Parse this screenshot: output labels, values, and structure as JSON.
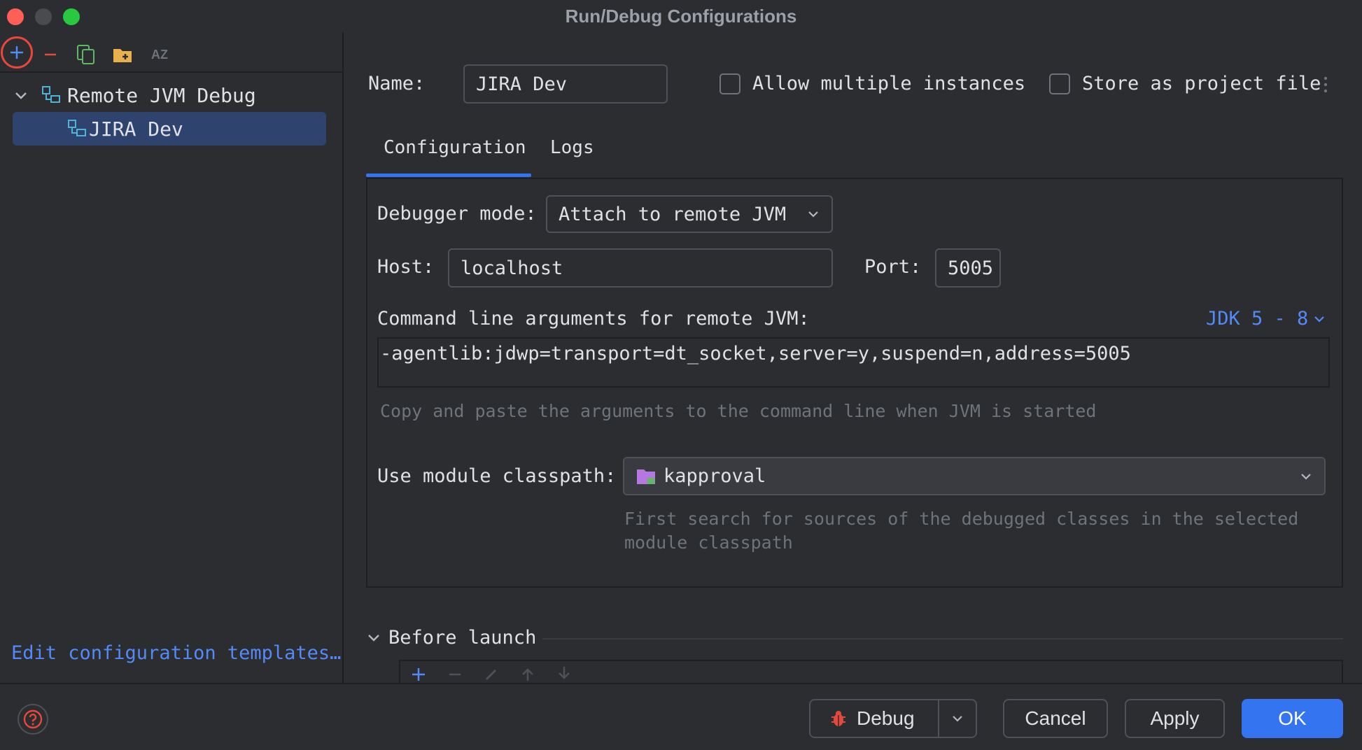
{
  "window": {
    "title": "Run/Debug Configurations"
  },
  "colors": {
    "background": "#2b2d30",
    "accent": "#3574f0",
    "link": "#548af7",
    "selection": "#2e436e",
    "close": "#ff5f57",
    "minimize": "#4a4b4f",
    "maximize": "#28c840"
  },
  "sidebar": {
    "toolbar": [
      {
        "icon": "plus-icon"
      },
      {
        "icon": "minus-icon"
      },
      {
        "icon": "copy-icon"
      },
      {
        "icon": "new-folder-icon"
      },
      {
        "icon": "sort-az-icon",
        "label": "AZ"
      }
    ],
    "tree": {
      "group_label": "Remote JVM Debug",
      "items": [
        {
          "label": "JIRA Dev",
          "selected": true
        }
      ]
    },
    "templates_link": "Edit configuration templates…"
  },
  "config": {
    "name_label": "Name:",
    "name_value": "JIRA Dev",
    "allow_multiple_label": "Allow multiple instances",
    "allow_multiple_checked": false,
    "store_as_project_label": "Store as project file",
    "store_as_project_checked": false,
    "tabs": [
      {
        "label": "Configuration",
        "active": true
      },
      {
        "label": "Logs",
        "active": false
      }
    ],
    "debugger_mode_label": "Debugger mode:",
    "debugger_mode_value": "Attach to remote JVM",
    "host_label": "Host:",
    "host_value": "localhost",
    "port_label": "Port:",
    "port_value": "5005",
    "cmd_args_label": "Command line arguments for remote JVM:",
    "jdk_selector": "JDK 5 - 8",
    "cmd_args_value": "-agentlib:jdwp=transport=dt_socket,server=y,suspend=n,address=5005",
    "cmd_hint": "Copy and paste the arguments to the command line when JVM is started",
    "module_label": "Use module classpath:",
    "module_value": "kapproval",
    "module_hint_line1": "First search for sources of the debugged classes in the selected",
    "module_hint_line2": "module classpath",
    "before_launch_label": "Before launch"
  },
  "footer": {
    "debug_label": "Debug",
    "cancel_label": "Cancel",
    "apply_label": "Apply",
    "ok_label": "OK"
  }
}
